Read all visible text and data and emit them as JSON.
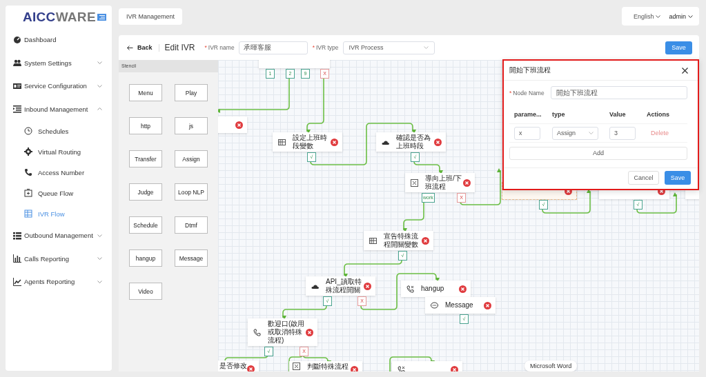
{
  "sidebar": {
    "logo": [
      "AICC",
      "WARE"
    ],
    "items": [
      {
        "label": "Dashboard"
      },
      {
        "label": "System Settings",
        "expanded": false
      },
      {
        "label": "Service Configuration",
        "expanded": false
      },
      {
        "label": "Inbound Management",
        "expanded": true,
        "children": [
          {
            "label": "Schedules",
            "selected": false
          },
          {
            "label": "Virtual Routing",
            "selected": false
          },
          {
            "label": "Access Number",
            "selected": false
          },
          {
            "label": "Queue Flow",
            "selected": false
          },
          {
            "label": "IVR Flow",
            "selected": true
          }
        ]
      },
      {
        "label": "Outbound Management",
        "expanded": false
      },
      {
        "label": "Calls Reporting",
        "expanded": false
      },
      {
        "label": "Agents Reporting",
        "expanded": false
      }
    ]
  },
  "top_bar": {
    "tabs": [
      {
        "label": "IVR Management"
      }
    ],
    "language": "English",
    "user": "admin"
  },
  "editor": {
    "back": "Back",
    "title": "Edit IVR",
    "fields": [
      {
        "label": "IVR name",
        "required": "*",
        "kind": "text",
        "value": "承暉客服"
      },
      {
        "label": "IVR type",
        "required": "*",
        "kind": "select",
        "value": "IVR Process"
      }
    ],
    "save": "Save"
  },
  "stencil": {
    "title": "Stencil",
    "items": [
      "Menu",
      "Play",
      "http",
      "js",
      "Transfer",
      "Assign",
      "Judge",
      "Loop NLP",
      "Schedule",
      "Dtmf",
      "hangup",
      "Message",
      "Video"
    ]
  },
  "canvas": {
    "nodes": [
      {
        "selected": false,
        "ports": [
          {
            "label": "1",
            "kind": "ok"
          },
          {
            "label": "2",
            "kind": "ok"
          },
          {
            "label": "9",
            "kind": "ok"
          },
          {
            "label": "X",
            "kind": "no"
          }
        ]
      },
      {
        "selected": false
      },
      {
        "kind": "assign",
        "label": "設定上班時段變數",
        "selected": false,
        "ports": [
          {
            "label": "√",
            "kind": "ok"
          }
        ]
      },
      {
        "kind": "http",
        "label": "確認是否為上班時段",
        "selected": false,
        "ports": [
          {
            "label": "√",
            "kind": "ok"
          }
        ]
      },
      {
        "kind": "judge",
        "label": "導向上班/下班流程",
        "selected": false,
        "ports": [
          {
            "label": "work",
            "kind": "ok"
          },
          {
            "label": "X",
            "kind": "no"
          }
        ]
      },
      {
        "selected": true,
        "ports": [
          {
            "label": "√",
            "kind": "ok"
          }
        ]
      },
      {
        "selected": false,
        "ports": [
          {
            "label": "√",
            "kind": "ok"
          }
        ]
      },
      {
        "selected": false
      },
      {
        "kind": "assign",
        "label": "宣告特殊流程開關變數",
        "selected": false,
        "ports": [
          {
            "label": "√",
            "kind": "ok"
          }
        ]
      },
      {
        "kind": "http",
        "label": "API_讀取特殊流程開關",
        "selected": false,
        "ports": [
          {
            "label": "√",
            "kind": "ok"
          },
          {
            "label": "X",
            "kind": "no"
          }
        ]
      },
      {
        "kind": "hangup",
        "label": "hangup",
        "selected": false
      },
      {
        "kind": "message",
        "label": "Message",
        "selected": false,
        "ports": [
          {
            "label": "√",
            "kind": "ok"
          }
        ]
      },
      {
        "kind": "play",
        "label": "歡迎口(啟用或取消特殊流程)",
        "selected": false,
        "ports": [
          {
            "label": "√",
            "kind": "ok"
          },
          {
            "label": "X",
            "kind": "no"
          }
        ]
      },
      {
        "label": "是否修改",
        "selected": false
      },
      {
        "kind": "judge",
        "label": "判斷特殊流程",
        "selected": false
      },
      {
        "kind": "hangup",
        "selected": false
      }
    ]
  },
  "dialog": {
    "title": "開始下班流程",
    "node_name": {
      "label": "Node Name",
      "required": "*",
      "value": "開始下班流程"
    },
    "columns": [
      "parame...",
      "type",
      "Value",
      "Actions"
    ],
    "rows": [
      {
        "parameter": "x",
        "type": "Assign",
        "value": "3",
        "action": "Delete"
      }
    ],
    "add": "Add",
    "cancel": "Cancel",
    "save": "Save"
  },
  "tooltip": "Microsoft Word"
}
